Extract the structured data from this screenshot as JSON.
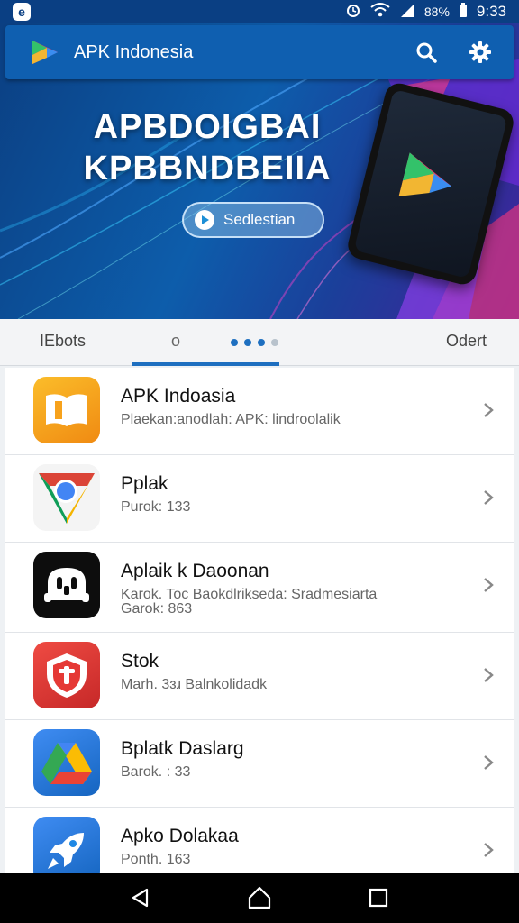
{
  "status": {
    "app_icon_letter": "e",
    "battery_percent": "88%",
    "time": "9:33"
  },
  "appbar": {
    "title": "APK Indonesia",
    "search_icon": "search-icon",
    "settings_icon": "gear-icon"
  },
  "hero": {
    "title_line1": "APBDOIGBAI",
    "title_line2": "KPBBNDBEIIA",
    "cta_label": "Sedlestian"
  },
  "tabs": {
    "left": "IEbots",
    "middle": "o",
    "right": "Odert",
    "dots_total": 4,
    "dots_active": 3
  },
  "apps": [
    {
      "title": "APK Indoasia",
      "subtitle": "Plaekan:anodlah: APK: lindroolalik",
      "icon": "book-icon",
      "accent": "#f7a21c"
    },
    {
      "title": "Pplak",
      "subtitle": "Purok: 133",
      "icon": "chrome-icon",
      "accent": "#db4437"
    },
    {
      "title": "Aplaik k Daoonan",
      "subtitle": "Karok. Toc Baokdlrikseda: Sradmesiarta",
      "subtitle2": "Garok: 863",
      "icon": "apk-robot-icon",
      "accent": "#111111"
    },
    {
      "title": "Stok",
      "subtitle": "Marh. 3ɜɹ Balnkolidadk",
      "icon": "shield-icon",
      "accent": "#e53935"
    },
    {
      "title": "Bplatk Daslarg",
      "subtitle": "Barok. : 33",
      "icon": "drive-icon",
      "accent": "#1e88e5"
    },
    {
      "title": "Apko Dolakaa",
      "subtitle": "Ponth. 163",
      "icon": "rocket-icon",
      "accent": "#1e88e5"
    }
  ],
  "navbar": {
    "back_icon": "back-triangle-icon",
    "home_icon": "home-icon",
    "recents_icon": "recents-square-icon"
  }
}
